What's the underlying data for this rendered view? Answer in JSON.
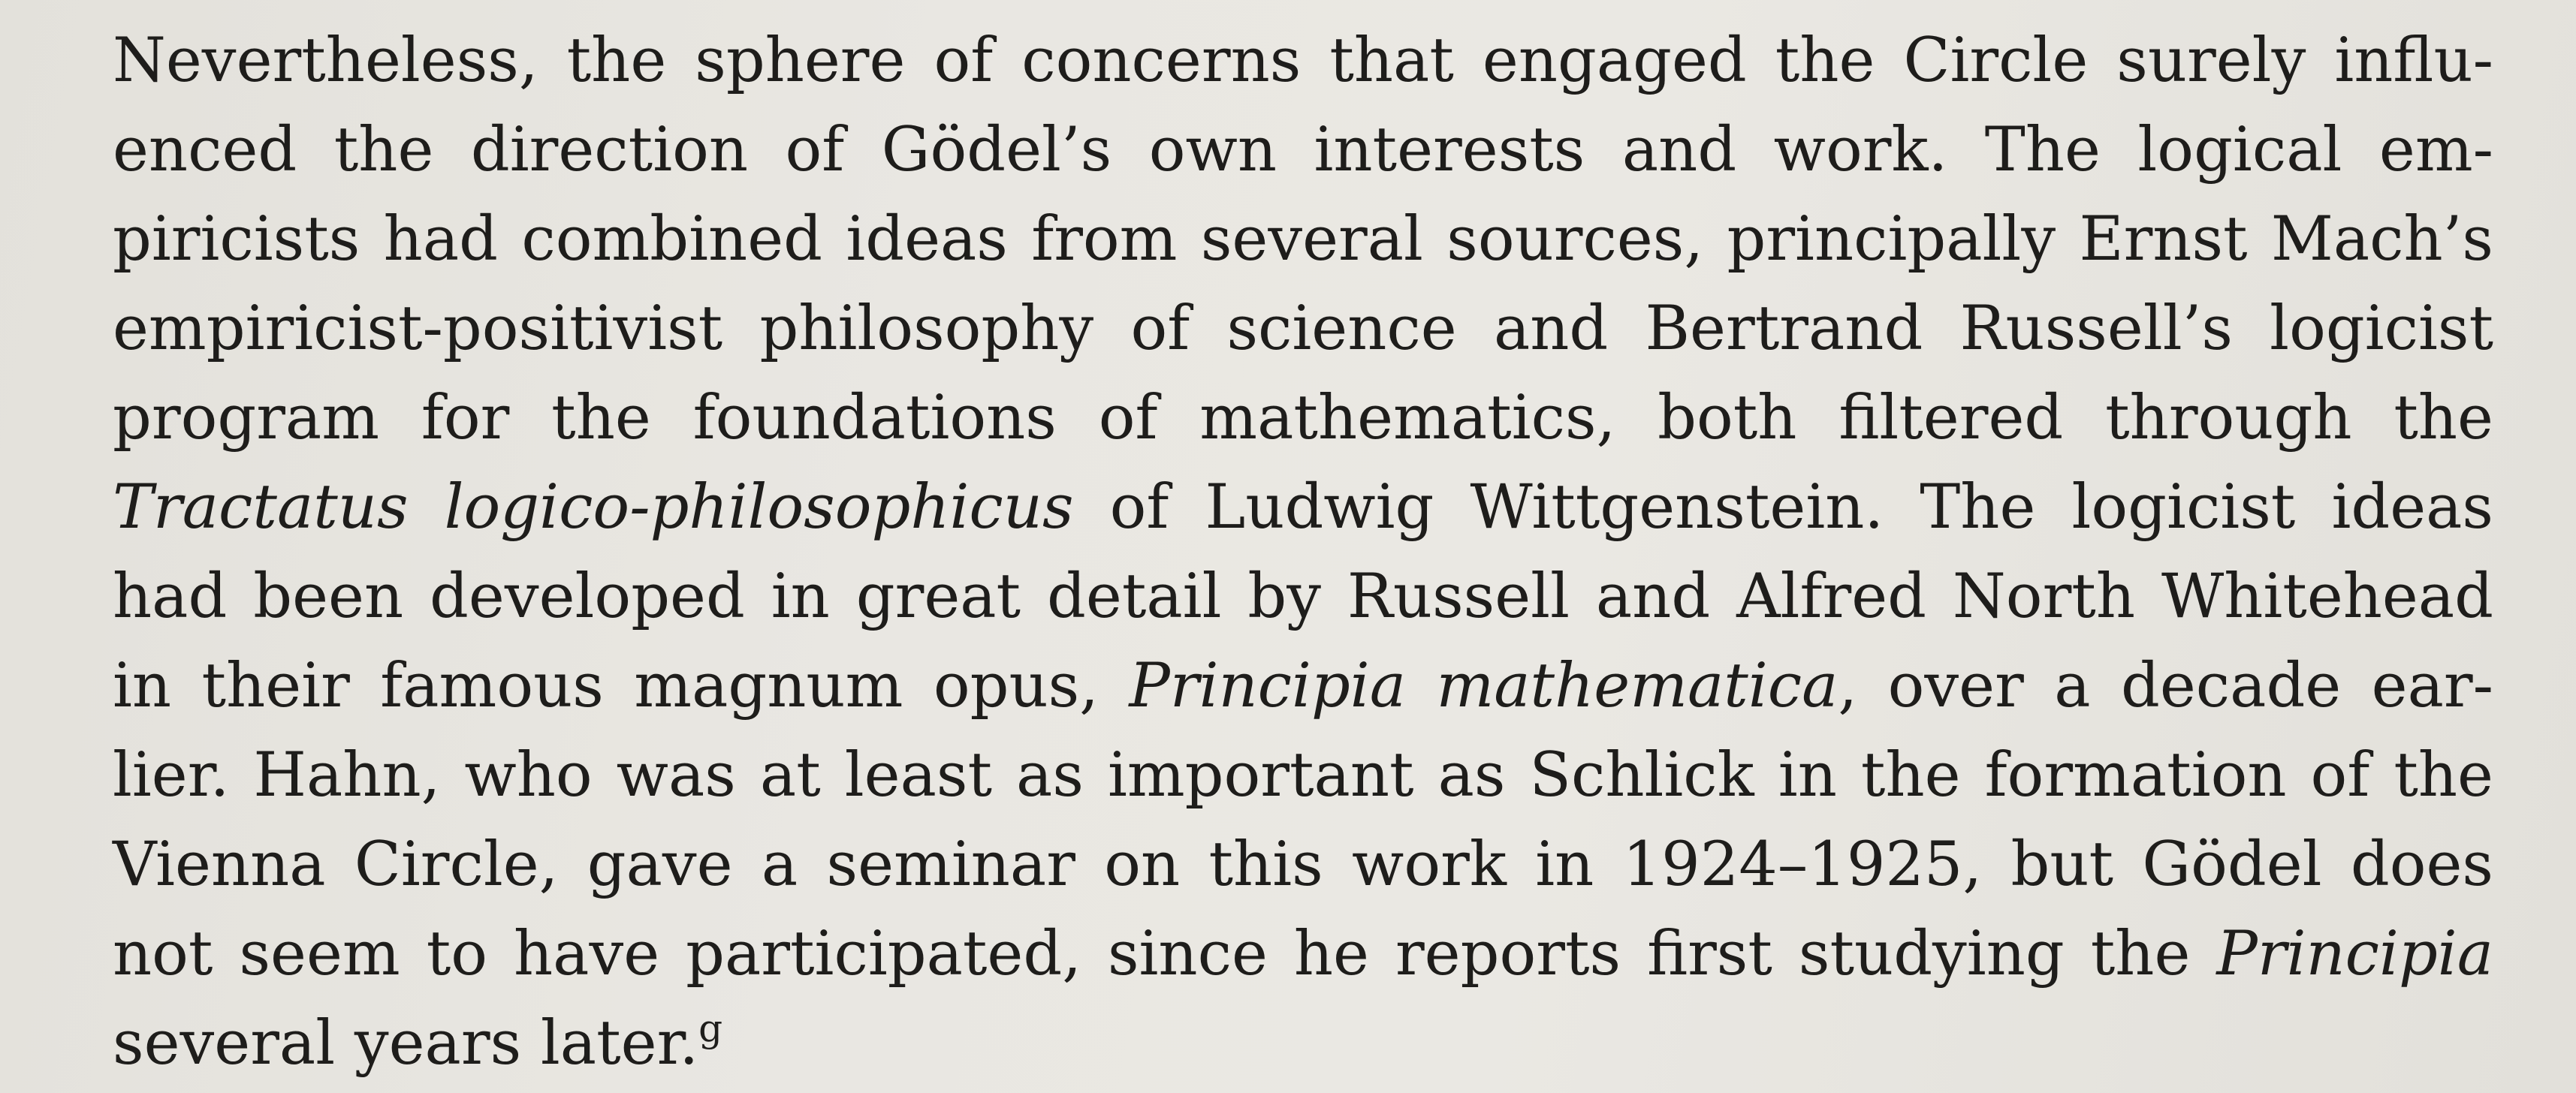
{
  "paragraph": {
    "lines": [
      {
        "a": "Nevertheless, the sphere of concerns that engaged the Circle surely influ-"
      },
      {
        "a": "enced the direction of Gödel’s own interests and work.  The logical em-"
      },
      {
        "a": "piricists had combined ideas from several sources, principally Ernst Mach’s"
      },
      {
        "a": "empiricist-positivist philosophy of science and Bertrand Russell’s logicist"
      },
      {
        "a": "program for the foundations of mathematics, both filtered through the"
      },
      {
        "i": "Tractatus logico-philosophicus",
        "b": " of Ludwig Wittgenstein.  The logicist ideas"
      },
      {
        "a": "had been developed in great detail by Russell and Alfred North Whitehead"
      },
      {
        "a": "in their famous magnum opus, ",
        "i": "Principia mathematica",
        "b": ", over a decade ear-"
      },
      {
        "a": "lier. Hahn, who was at least as important as Schlick in the formation of the"
      },
      {
        "a": "Vienna Circle, gave a seminar on this work in 1924–1925, but Gödel does"
      },
      {
        "a": "not seem to have participated, since he reports first studying the ",
        "i": "Principia"
      },
      {
        "a": "several years later.",
        "sup": "g"
      }
    ]
  }
}
